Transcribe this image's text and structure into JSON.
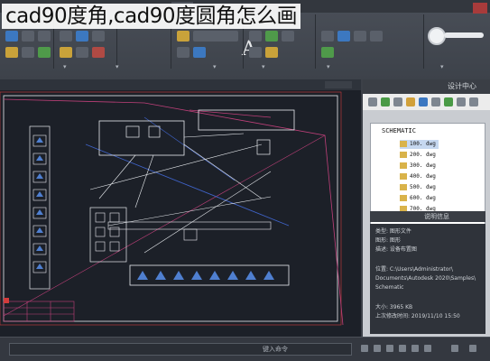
{
  "page": {
    "overlay_title": "cad90度角,cad90度圆角怎么画"
  },
  "ribbon": {
    "big_letter": "A",
    "group_footers": [
      "▾",
      "▾",
      "▾",
      "▾",
      "▾",
      "▾"
    ]
  },
  "palette": {
    "title": "设计中心",
    "tree_root": "SCHEMATIC",
    "items": [
      "100. dwg",
      "200. dwg",
      "300. dwg",
      "400. dwg",
      "500. dwg",
      "600. dwg",
      "700. dwg"
    ],
    "section_label": "说明信息",
    "info_lines": [
      "类型:  图形文件",
      "图形:  图形",
      "描述:  设备布置图",
      "",
      "位置:  C:\\Users\\Administrator\\",
      "Documents\\Autodesk 2020\\Samples\\",
      "Schematic",
      "",
      "大小:  3965 KB",
      "上次修改时间: 2019/11/10 15:50"
    ]
  },
  "statusbar": {
    "command_hint": "键入命令"
  },
  "colors": {
    "drawing_bg": "#1c2028",
    "ribbon_bg": "#444952",
    "palette_bg": "#c9ccd1",
    "line_white": "#e9ecf0",
    "line_magenta": "#c0407a",
    "line_blue": "#3f63c8",
    "line_red": "#d23b3b"
  },
  "icons": [
    "close-icon",
    "settings-icon",
    "folder-icon",
    "search-icon"
  ]
}
